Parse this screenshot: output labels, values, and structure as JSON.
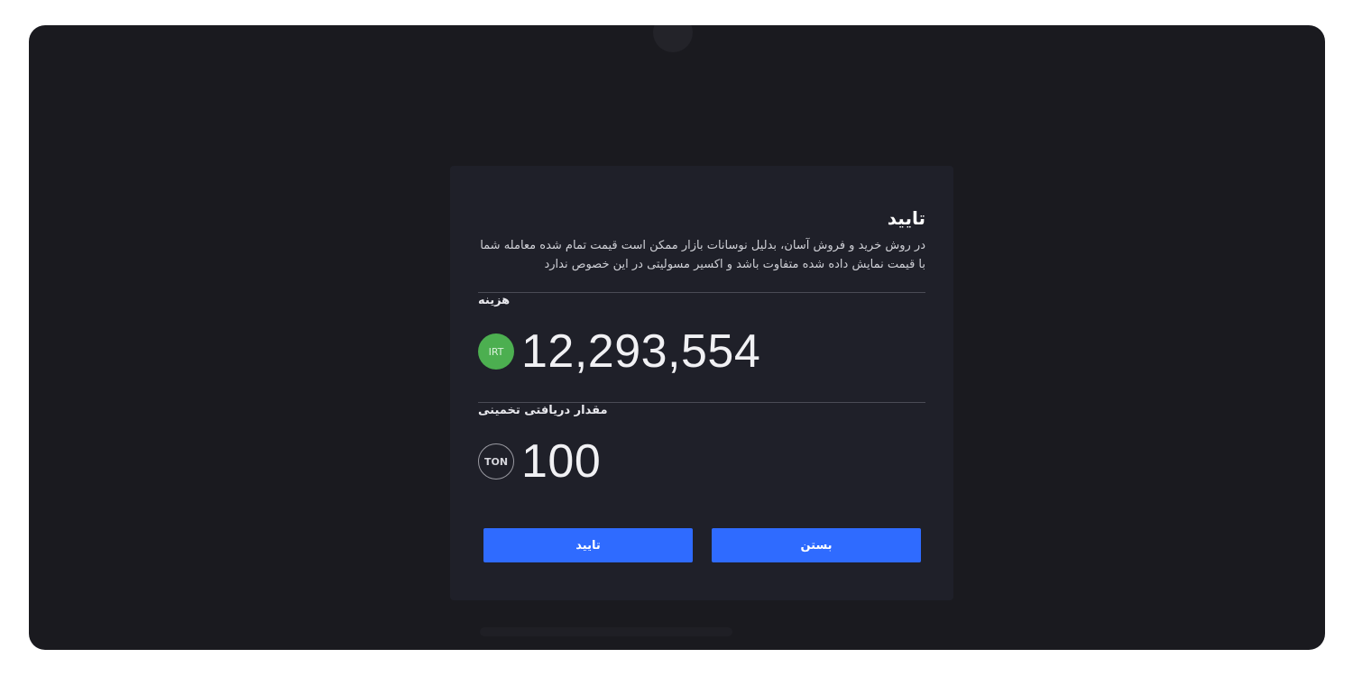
{
  "modal": {
    "title": "تایید",
    "description": "در روش خرید و فروش آسان، بدلیل نوسانات بازار ممکن است قیمت تمام شده معامله شما با قیمت نمایش داده شده متفاوت باشد و اکسیر مسولیتی در این خصوص ندارد",
    "cost": {
      "label": "هزینه",
      "currency": "IRT",
      "value": "12,293,554"
    },
    "receive": {
      "label": "مقدار دریافتی تخمینی",
      "currency": "TON",
      "value": "100"
    },
    "buttons": {
      "confirm_label": "تایید",
      "close_label": "بستن"
    }
  },
  "colors": {
    "overlay": "#1a1a1f",
    "modal_bg": "#1f2029",
    "button": "#2f6bff",
    "irt_badge": "#4caf50"
  }
}
